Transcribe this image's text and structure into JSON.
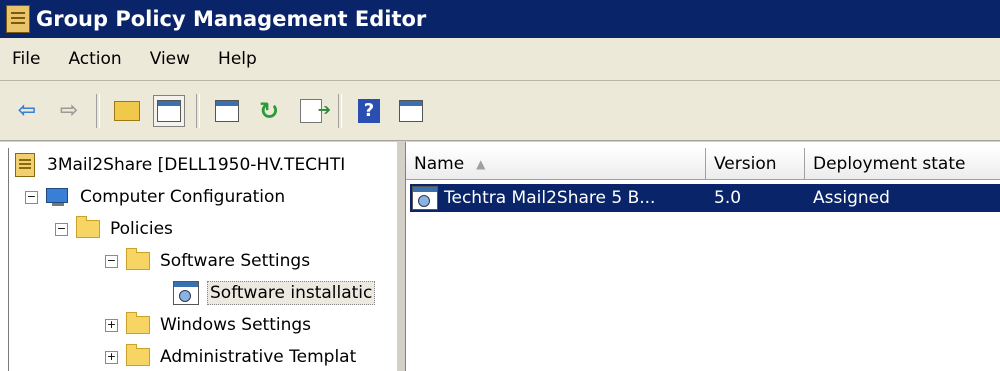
{
  "window": {
    "title": "Group Policy Management Editor"
  },
  "menu": [
    "File",
    "Action",
    "View",
    "Help"
  ],
  "toolbar": {
    "buttons": [
      "back-arrow-icon",
      "forward-arrow-icon",
      "up-folder-icon",
      "show-hide-tree-icon",
      "properties-icon",
      "refresh-icon",
      "export-list-icon",
      "help-icon",
      "action-pane-icon"
    ]
  },
  "tree": {
    "root": "3Mail2Share [DELL1950-HV.TECHTI",
    "computer_configuration": "Computer Configuration",
    "policies": "Policies",
    "software_settings": "Software Settings",
    "software_installation": "Software installatic",
    "windows_settings": "Windows Settings",
    "administrative_templates": "Administrative Templat"
  },
  "list": {
    "columns": [
      "Name",
      "Version",
      "Deployment state"
    ],
    "rows": [
      {
        "name": "Techtra Mail2Share 5 B...",
        "version": "5.0",
        "state": "Assigned"
      }
    ]
  }
}
